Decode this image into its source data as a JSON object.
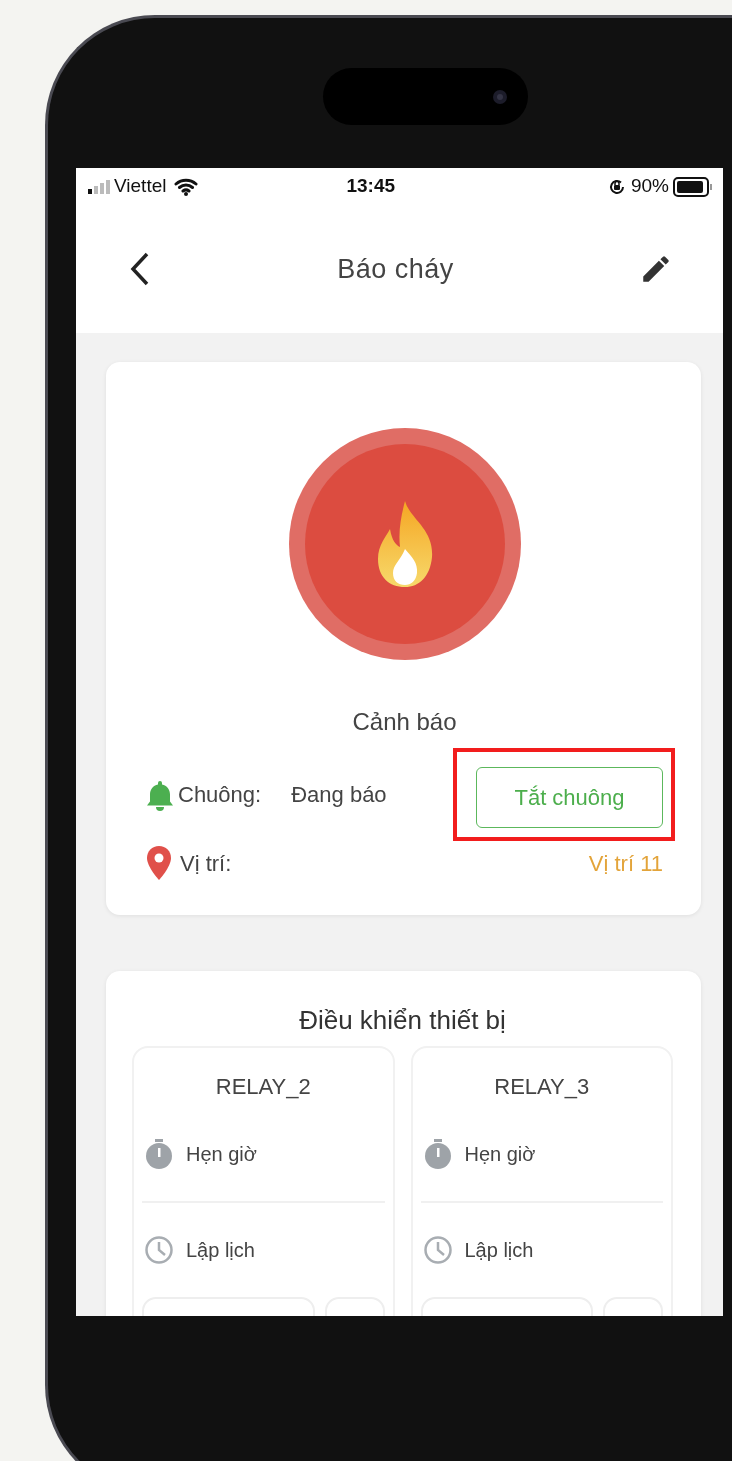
{
  "status_bar": {
    "carrier": "Viettel",
    "time": "13:45",
    "battery": "90%"
  },
  "header": {
    "title": "Báo cháy"
  },
  "alarm": {
    "status_title": "Cảnh báo",
    "bell_label": "Chuông:",
    "bell_state": "Đang báo",
    "mute_button": {
      "label": "Tắt chuông",
      "highlighted": true
    },
    "location_label": "Vị trí:",
    "location_value": "Vị trí 11"
  },
  "controls": {
    "title": "Điều khiển thiết bị",
    "relays": [
      {
        "name": "RELAY_2",
        "items": [
          {
            "kind": "timer",
            "label": "Hẹn giờ"
          },
          {
            "kind": "schedule",
            "label": "Lập lịch"
          }
        ]
      },
      {
        "name": "RELAY_3",
        "items": [
          {
            "kind": "timer",
            "label": "Hẹn giờ"
          },
          {
            "kind": "schedule",
            "label": "Lập lịch"
          }
        ]
      }
    ]
  }
}
